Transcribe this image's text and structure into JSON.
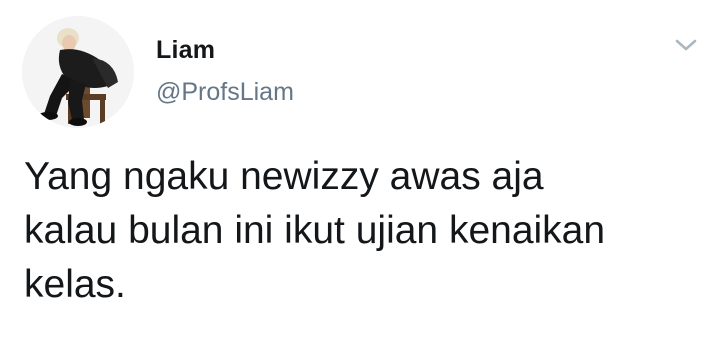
{
  "tweet": {
    "display_name": "Liam",
    "handle": "@ProfsLiam",
    "text": "Yang ngaku newizzy awas aja\nkalau bulan ini ikut ujian kenaikan\nkelas."
  },
  "icons": {
    "menu": "chevron-down-icon",
    "avatar": "avatar"
  },
  "colors": {
    "text_primary": "#14171a",
    "text_secondary": "#657786",
    "chevron": "#aab8c2"
  }
}
